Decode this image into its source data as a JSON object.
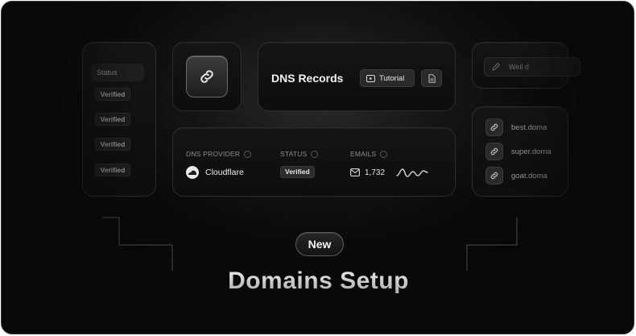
{
  "left_card": {
    "status_header": "Status",
    "badges": [
      "Verified",
      "Verified",
      "Verified",
      "Verified"
    ]
  },
  "dns_card": {
    "title": "DNS Records",
    "tutorial_label": "Tutorial"
  },
  "provider_card": {
    "provider_label": "DNS PROVIDER",
    "provider_value": "Cloudflare",
    "status_label": "STATUS",
    "status_value": "Verified",
    "emails_label": "EMAILS",
    "emails_value": "1,732"
  },
  "right_card": {
    "wall_label": "Well d",
    "domains": [
      "best.doma",
      "super.doma",
      "goat.doma"
    ]
  },
  "hero": {
    "badge": "New",
    "title": "Domains Setup"
  }
}
